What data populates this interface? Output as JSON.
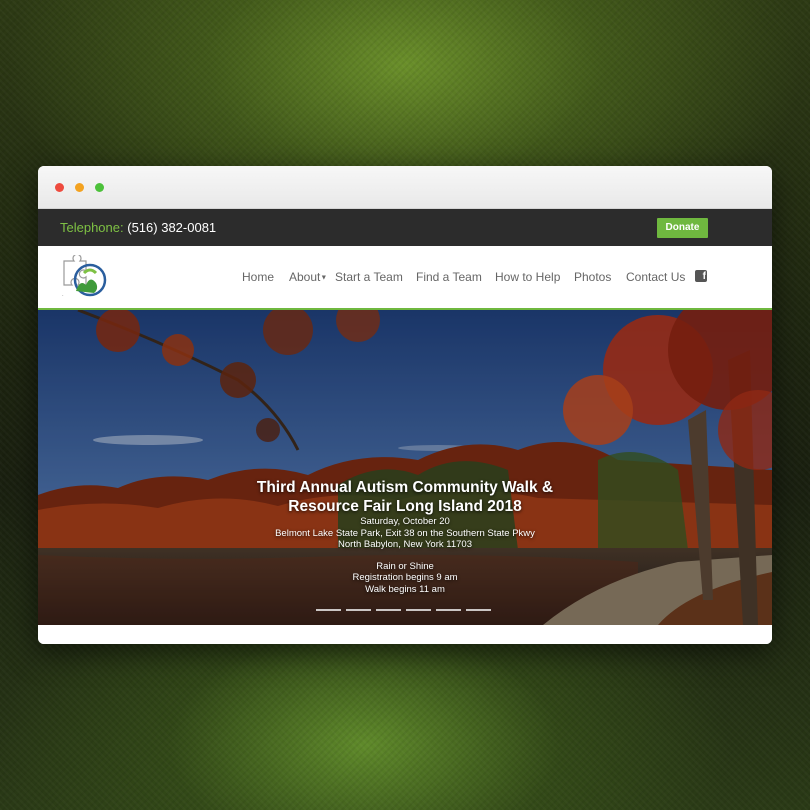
{
  "topbar": {
    "phone_label": "Telephone:",
    "phone_number": "(516) 382-0081",
    "donate_label": "Donate"
  },
  "nav": {
    "items": [
      "Home",
      "About",
      "Start a Team",
      "Find a Team",
      "How to Help",
      "Photos",
      "Contact Us"
    ],
    "social_icon": "facebook-icon"
  },
  "hero": {
    "title_line1": "Third Annual Autism Community Walk &",
    "title_line2": "Resource Fair Long Island 2018",
    "date": "Saturday, October 20",
    "location_line1": "Belmont Lake State Park, Exit 38 on the Southern State Pkwy",
    "location_line2": "North Babylon, New York 11703",
    "weather": "Rain or Shine",
    "registration": "Registration begins 9 am",
    "walk_time": "Walk begins 11 am",
    "slide_count": 6
  },
  "colors": {
    "accent_green": "#6fb83f",
    "topbar_bg": "#2c2c2c",
    "nav_text": "#666666"
  }
}
